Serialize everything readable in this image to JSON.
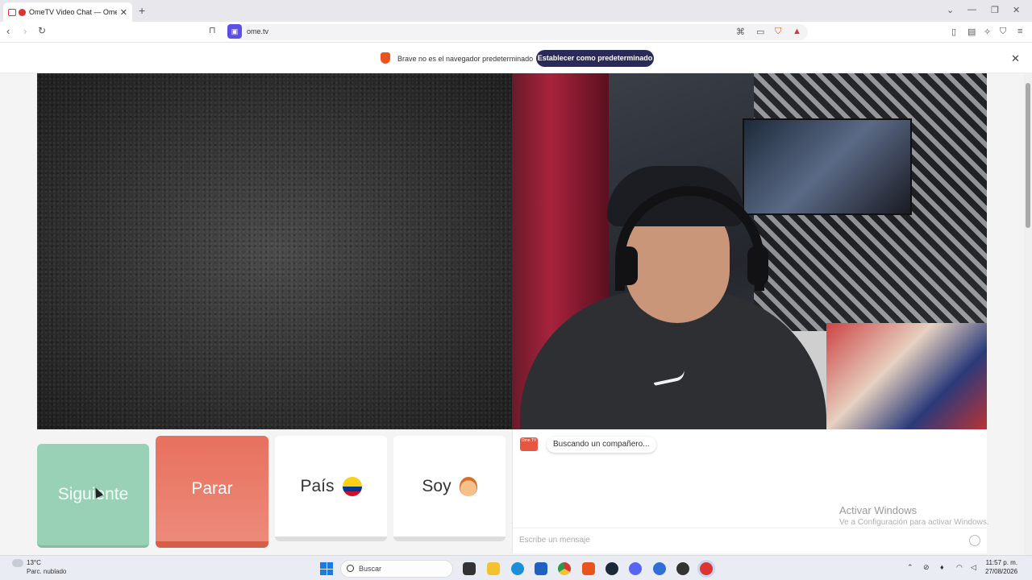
{
  "browser": {
    "tab_title": "OmeTV Video Chat — Omeg",
    "tab_close": "✕",
    "new_tab": "+",
    "url": "ome.tv",
    "site_icon": "▣"
  },
  "notification": {
    "message": "Brave no es el navegador predeterminado",
    "button_label": "Establecer como predeterminado",
    "close": "✕"
  },
  "controls": {
    "next_label": "Siguiente",
    "stop_label": "Parar",
    "country_label": "País",
    "gender_label": "Soy"
  },
  "chat": {
    "logo_text": "Ome TV",
    "status_text": "Buscando un compañero...",
    "input_placeholder": "Escribe un mensaje"
  },
  "windows_watermark": {
    "title": "Activar Windows",
    "subtitle": "Ve a Configuración para activar Windows."
  },
  "taskbar": {
    "weather_temp": "13°C",
    "weather_desc": "Parc. nublado",
    "search_label": "Buscar",
    "time": "11:57 p. m.",
    "date": "27/08/2026"
  },
  "colors": {
    "next_button": "#98d1b5",
    "stop_button": "#e8705e",
    "notification_button": "#2a2a5a",
    "site_icon": "#5b4fe8"
  },
  "icons": [
    "back-icon",
    "forward-icon",
    "reload-icon",
    "bookmark-icon",
    "translate-icon",
    "brave-shield-icon",
    "brave-rewards-icon",
    "sidebar-icon",
    "wallet-icon",
    "leo-icon",
    "vpn-icon",
    "menu-icon",
    "emoji-icon",
    "windows-start-icon",
    "search-icon"
  ]
}
